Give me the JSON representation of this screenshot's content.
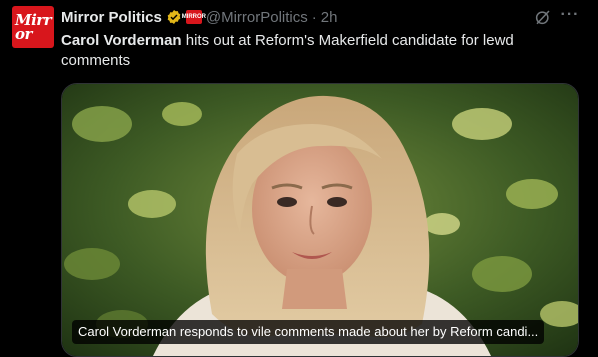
{
  "tweet": {
    "author": {
      "name": "Mirror Politics",
      "handle": "@MirrorPolitics",
      "avatar_line1": "Mirr",
      "avatar_line2": "or",
      "affiliate_badge": "MIRROR",
      "verified": true
    },
    "separator": "·",
    "time": "2h",
    "text_bold": "Carol Vorderman",
    "text_rest": " hits out at Reform's Makerfield candidate for lewd comments",
    "media": {
      "caption": "Carol Vorderman responds to vile comments made about her by Reform candi..."
    },
    "actions": {
      "grok_icon": "grok-icon",
      "more_label": "···"
    }
  },
  "colors": {
    "background": "#000000",
    "text_primary": "#e7e9ea",
    "text_secondary": "#71767b",
    "brand_red": "#d8161c",
    "verified_gold": "#e2b719"
  }
}
